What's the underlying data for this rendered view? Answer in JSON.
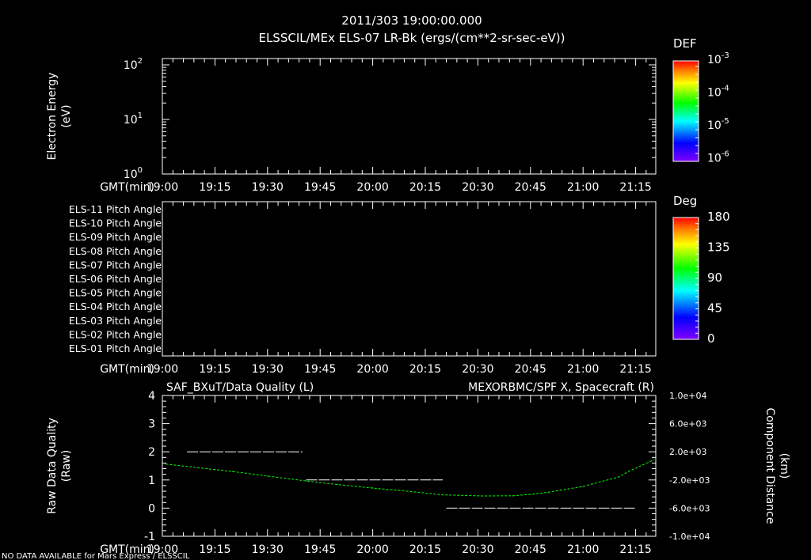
{
  "header": {
    "time": "2011/303 19:00:00.000",
    "title": "ELSSCIL/MEx ELS-07 LR-Bk  (ergs/(cm**2-sr-sec-eV))"
  },
  "status": "NO DATA AVAILABLE for Mars Express / ELSSCIL",
  "colors": {
    "background": "#000000",
    "axes": "#ffffff",
    "quality_line": "#ffffff",
    "position_line": "#00ff00"
  },
  "time_axis": {
    "label": "GMT(min)",
    "ticks": [
      "19:00",
      "19:15",
      "19:30",
      "19:45",
      "20:00",
      "20:15",
      "20:30",
      "20:45",
      "21:00",
      "21:15"
    ],
    "range": [
      "19:00",
      "21:21"
    ]
  },
  "chart_data": [
    {
      "type": "heatmap",
      "ylabel": [
        "Electron Energy",
        "(eV)"
      ],
      "yscale": "log",
      "ylim": [
        1,
        130
      ],
      "ytick_labels": [
        {
          "base": "10",
          "exp": "0"
        },
        {
          "base": "10",
          "exp": "1"
        },
        {
          "base": "10",
          "exp": "2"
        }
      ],
      "colorbar": {
        "title": "DEF",
        "scale": "log",
        "labels": [
          {
            "base": "10",
            "exp": "-3"
          },
          {
            "base": "10",
            "exp": "-4"
          },
          {
            "base": "10",
            "exp": "-5"
          },
          {
            "base": "10",
            "exp": "-6"
          }
        ],
        "colormap": "rainbow"
      },
      "values": []
    },
    {
      "type": "heatmap",
      "row_labels": [
        "ELS-11 Pitch Angle",
        "ELS-10 Pitch Angle",
        "ELS-09 Pitch Angle",
        "ELS-08 Pitch Angle",
        "ELS-07 Pitch Angle",
        "ELS-06 Pitch Angle",
        "ELS-05 Pitch Angle",
        "ELS-04 Pitch Angle",
        "ELS-03 Pitch Angle",
        "ELS-02 Pitch Angle",
        "ELS-01 Pitch Angle"
      ],
      "colorbar": {
        "title": "Deg",
        "labels": [
          "180",
          "135",
          "90",
          "45",
          "0"
        ],
        "range": [
          0,
          180
        ],
        "colormap": "rainbow"
      },
      "values": []
    },
    {
      "type": "line",
      "title_left": "SAF_BXuT/Data Quality (L)",
      "title_right": "MEXORBMC/SPF X, Spacecraft (R)",
      "ylabel_left": [
        "Raw Data Quality",
        "(Raw)"
      ],
      "ylabel_right": [
        "Component Distance",
        "(km)"
      ],
      "ylim_left": [
        -1,
        4
      ],
      "ytick_labels_left": [
        "4",
        "3",
        "2",
        "1",
        "0",
        "-1"
      ],
      "ylim_right": [
        -10000,
        10000
      ],
      "ytick_labels_right": [
        "1.0e+04",
        "6.0e+03",
        "2.0e+03",
        "-2.0e+03",
        "-6.0e+03",
        "-1.0e+04"
      ],
      "series": [
        {
          "axis": "left",
          "style": "dashed",
          "color": "#ffffff",
          "segments": [
            {
              "x": [
                "19:07",
                "19:40"
              ],
              "y": 2
            },
            {
              "x": [
                "19:41",
                "20:20"
              ],
              "y": 1
            },
            {
              "x": [
                "20:21",
                "21:15"
              ],
              "y": 0
            }
          ]
        },
        {
          "axis": "right",
          "style": "dotted",
          "color": "#00ff00",
          "x": [
            "19:01",
            "19:10",
            "19:20",
            "19:30",
            "19:41",
            "19:50",
            "20:00",
            "20:10",
            "20:20",
            "20:31",
            "20:40",
            "20:45",
            "20:50",
            "21:00",
            "21:10",
            "21:13",
            "21:20"
          ],
          "y": [
            260,
            -250,
            -800,
            -1450,
            -2140,
            -2650,
            -3150,
            -3600,
            -4120,
            -4270,
            -4250,
            -4050,
            -3750,
            -2920,
            -1600,
            -790,
            820
          ]
        }
      ]
    }
  ]
}
